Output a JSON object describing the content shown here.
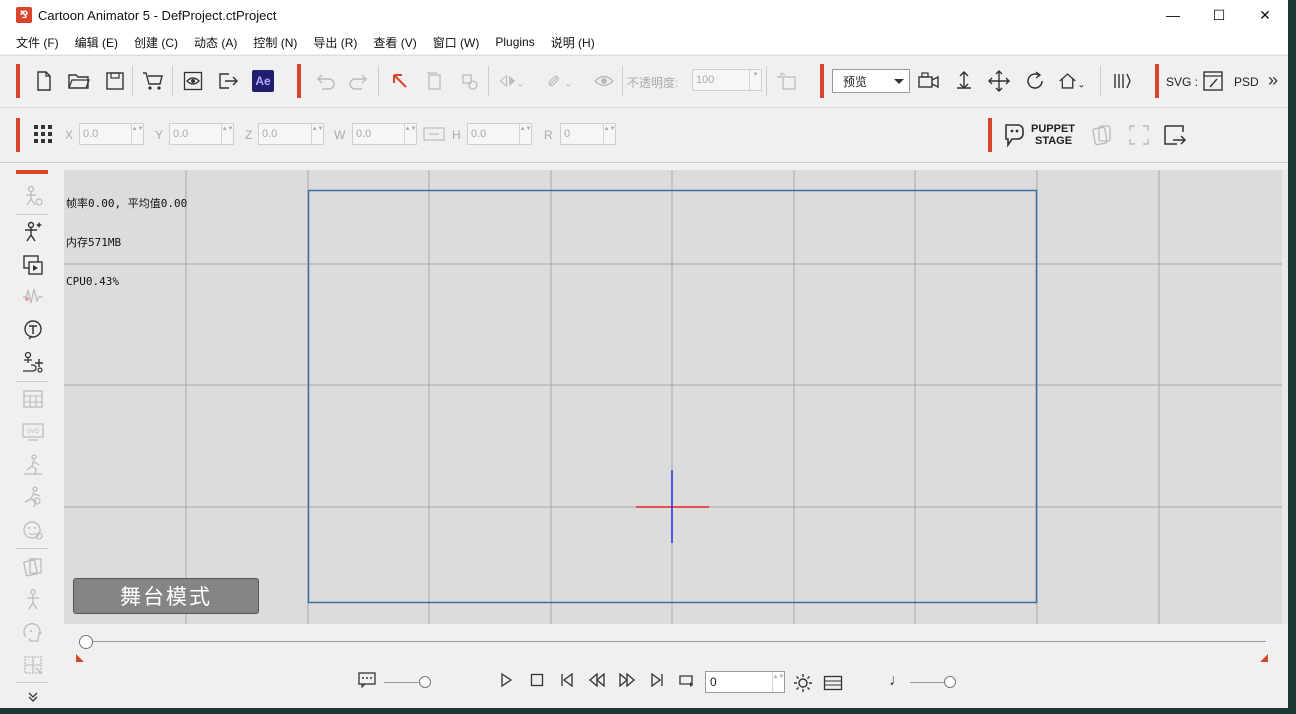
{
  "window": {
    "title": "Cartoon Animator 5 - DefProject.ctProject",
    "app_icon_glyph": "⅋",
    "controls": {
      "minimize": "—",
      "maximize": "☐",
      "close": "✕"
    }
  },
  "menu": [
    "文件 (F)",
    "编辑 (E)",
    "创建 (C)",
    "动态 (A)",
    "控制 (N)",
    "导出 (R)",
    "查看 (V)",
    "窗口 (W)",
    "Plugins",
    "说明 (H)"
  ],
  "toolbar": {
    "ae_label": "Ae",
    "opacity_label": "不透明度:",
    "opacity_value": "100",
    "preset_value": "预览",
    "svg_label": "SVG :",
    "psd_label": "PSD",
    "more": "»"
  },
  "transform": {
    "x_label": "X",
    "x_value": "0.0",
    "y_label": "Y",
    "y_value": "0.0",
    "z_label": "Z",
    "z_value": "0.0",
    "w_label": "W",
    "w_value": "0.0",
    "h_label": "H",
    "h_value": "0.0",
    "r_label": "R",
    "r_value": "0",
    "puppet_line1": "PUPPET",
    "puppet_line2": "STAGE"
  },
  "stage": {
    "stats_fps": "帧率0.00, 平均值0.00",
    "stats_mem": "内存571MB",
    "stats_cpu": "CPU0.43%",
    "mode_label": "舞台模式"
  },
  "timeline": {
    "frame_value": "0",
    "music_glyph": "♩"
  },
  "colors": {
    "accent": "#d9442b",
    "stage_bg": "#dcdcdc",
    "frame_border": "#3a6ea5",
    "axis_x": "#e02020",
    "axis_y": "#2030e0"
  }
}
